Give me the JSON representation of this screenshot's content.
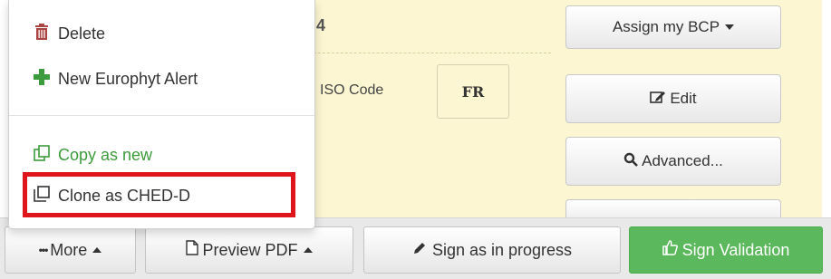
{
  "background": {
    "heading_fragment": "4",
    "iso_label": "ISO Code",
    "iso_value": "FR"
  },
  "side_buttons": {
    "assign_label": "Assign my BCP",
    "edit_label": "Edit",
    "advanced_label": "Advanced..."
  },
  "dropdown_menu": {
    "delete_label": "Delete",
    "europhyt_label": "New Europhyt Alert",
    "copy_label": "Copy as new",
    "clone_label": "Clone as CHED-D"
  },
  "bottom_toolbar": {
    "more_label": "More",
    "preview_label": "Preview PDF",
    "sign_progress_label": "Sign as in progress",
    "sign_validation_label": "Sign Validation"
  },
  "colors": {
    "panel_bg": "#fcf6d2",
    "highlight": "#e0141b",
    "delete_icon": "#a94442",
    "add_icon": "#3c9b3c",
    "copy_link": "#3c9b3c",
    "validation_button": "#5cb85c"
  },
  "icons": {
    "delete": "trash-icon",
    "europhyt": "plus-icon",
    "copy": "copy-icon",
    "clone": "clone-icon",
    "edit": "edit-icon",
    "advanced": "search-icon",
    "more": "ellipsis-icon",
    "preview": "file-icon",
    "sign_progress": "pencil-icon",
    "sign_validation": "thumbs-up-icon"
  }
}
